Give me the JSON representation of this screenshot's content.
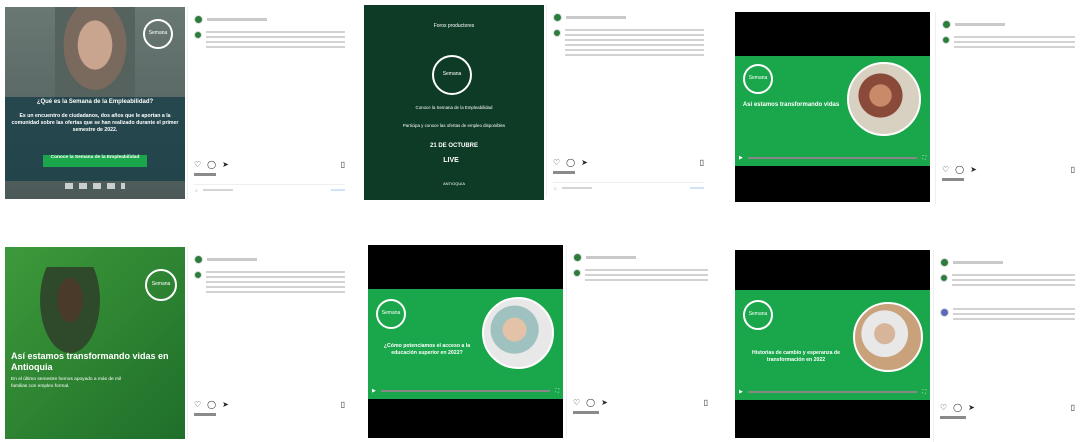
{
  "cards": [
    {
      "media_text": {
        "question": "¿Qué es la Semana de la Empleabilidad?",
        "body": "Es un encuentro de ciudadanos, dos años que le aportan a la comunidad sobre las ofertas que se han realizado durante el primer semestre de 2022.",
        "button": "Conoce la Semana de la Empleabilidad",
        "logo": "Semana"
      }
    },
    {
      "media_text": {
        "heading": "Foros productores",
        "logo": "Semana",
        "body": "Conoce la Semana de la Empleabilidad",
        "body2": "Participa y conoce las ofertas de empleo disponibles",
        "date": "21 DE OCTUBRE",
        "live": "LIVE",
        "footer": "ANTIOQUIA"
      }
    },
    {
      "media_text": {
        "logo": "Semana",
        "headline": "Así estamos transformando vidas"
      }
    },
    {
      "media_text": {
        "logo": "Semana",
        "headline": "Así estamos transformando vidas en Antioquia",
        "body": "En el último semestre hemos apoyado a más de mil familias con empleo formal."
      }
    },
    {
      "media_text": {
        "logo": "Semana",
        "headline": "¿Cómo potenciamos el acceso a la educación superior en 2022?"
      }
    },
    {
      "media_text": {
        "logo": "Semana",
        "headline": "Historias de cambio y esperanza de transformación en 2022"
      }
    }
  ],
  "ui": {
    "like_icon": "heart-icon",
    "comment_icon": "comment-icon",
    "share_icon": "share-icon",
    "save_icon": "bookmark-icon",
    "live_label": "LIVE"
  }
}
